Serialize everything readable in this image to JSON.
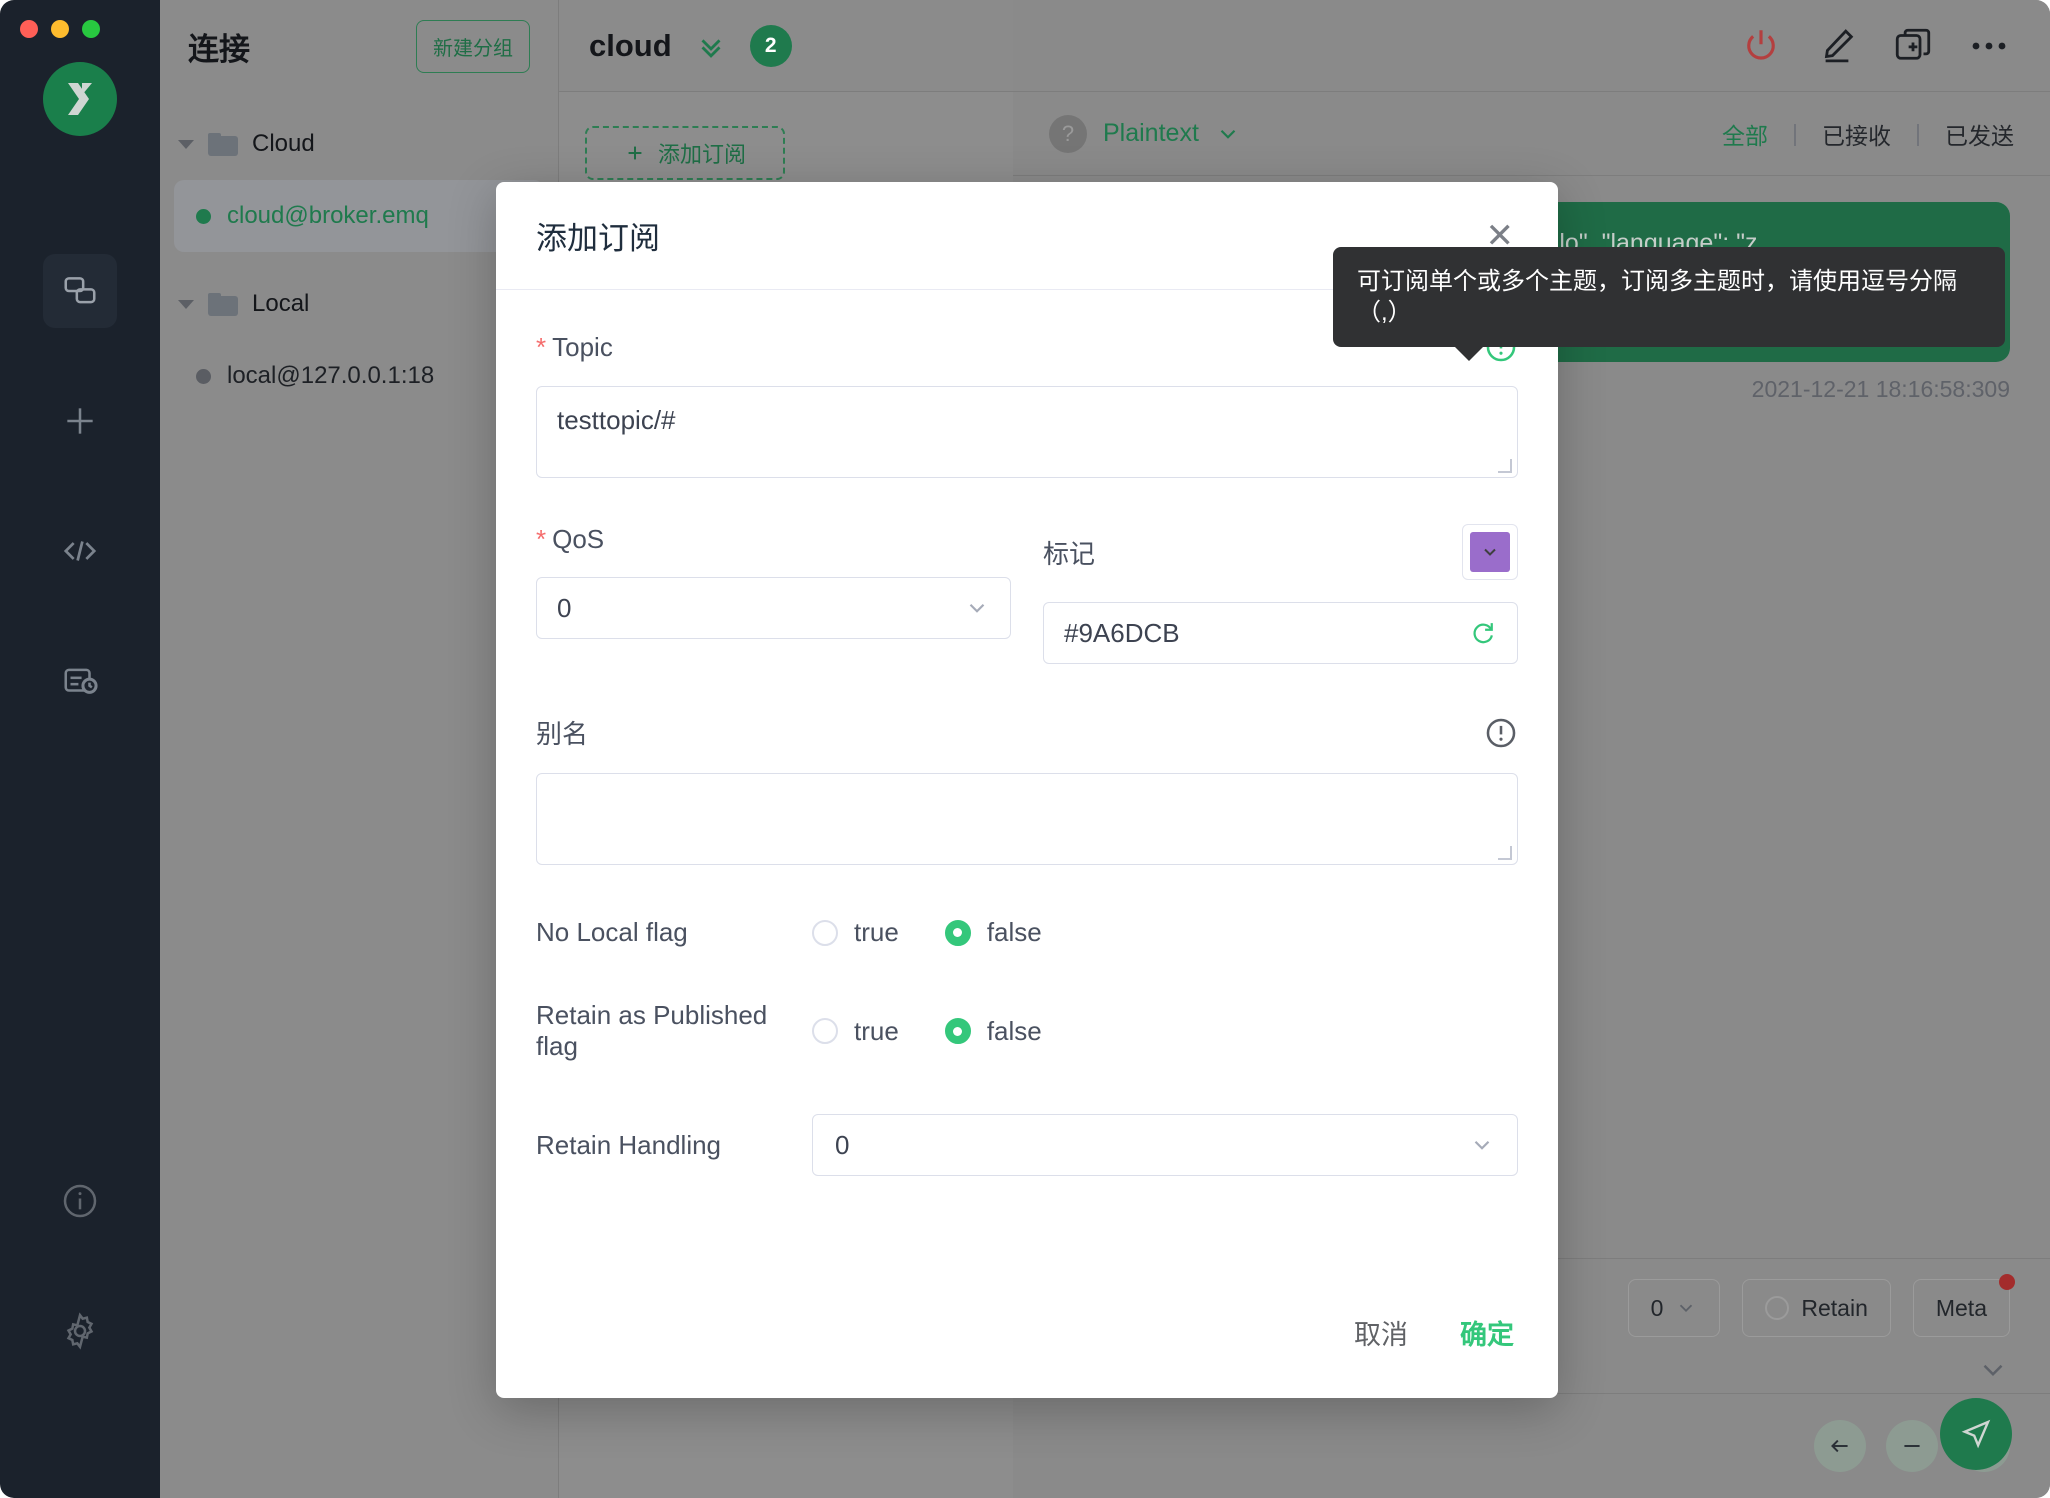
{
  "window": {
    "traffic_lights": [
      "close",
      "minimize",
      "maximize"
    ],
    "brand": "MQTTX"
  },
  "rail": {
    "items": [
      {
        "name": "connections-icon",
        "label": "Connections",
        "active": true
      },
      {
        "name": "new-connection-icon",
        "label": "New Connection",
        "active": false
      },
      {
        "name": "script-icon",
        "label": "Script",
        "active": false
      },
      {
        "name": "log-icon",
        "label": "Log",
        "active": false
      }
    ],
    "bottom_items": [
      {
        "name": "about-icon",
        "label": "About"
      },
      {
        "name": "settings-icon",
        "label": "Settings"
      }
    ]
  },
  "connections": {
    "title": "连接",
    "new_group_label": "新建分组",
    "groups": [
      {
        "name": "Cloud",
        "items": [
          {
            "label": "cloud@broker.emq",
            "connected": true,
            "selected": true
          }
        ]
      },
      {
        "name": "Local",
        "items": [
          {
            "label": "local@127.0.0.1:18",
            "connected": false,
            "selected": false
          }
        ]
      }
    ]
  },
  "connection_tab": {
    "name": "cloud",
    "badge": "2",
    "collapse_icon": "double-chevron-down-icon",
    "actions": [
      {
        "name": "disconnect-icon",
        "label": "Disconnect"
      },
      {
        "name": "edit-icon",
        "label": "Edit"
      },
      {
        "name": "new-window-icon",
        "label": "New"
      },
      {
        "name": "more-icon",
        "label": "More"
      }
    ]
  },
  "subscriptions": {
    "add_label": "添加订阅",
    "collapse_icon": "collapse-list-icon"
  },
  "messages": {
    "help_icon": "question-icon",
    "format": "Plaintext",
    "filters": [
      {
        "label": "全部",
        "active": true
      },
      {
        "label": "已接收",
        "active": false
      },
      {
        "label": "已发送",
        "active": false
      }
    ],
    "bubble": {
      "payload": ": { \"test\": \"hello\", \"language\": \"z",
      "timestamp": "2021-12-21 18:16:58:309"
    },
    "footer": {
      "qos_value": "0",
      "retain_label": "Retain",
      "meta_label": "Meta",
      "nav_back_icon": "arrow-left-icon",
      "nav_minus_icon": "minus-icon",
      "nav_forward_icon": "arrow-right-icon",
      "send_icon": "send-icon"
    }
  },
  "modal": {
    "title": "添加订阅",
    "close_icon": "close-icon",
    "topic": {
      "label": "Topic",
      "required": true,
      "value": "testtopic/#",
      "info_icon": "info-circle-icon",
      "info_icon_color": "#34c77b"
    },
    "qos": {
      "label": "QoS",
      "required": true,
      "value": "0",
      "chevron_icon": "chevron-down-icon"
    },
    "tag": {
      "label": "标记",
      "value": "#9A6DCB",
      "swatch_color": "#9A6DCB",
      "swatch_chevron_icon": "chevron-down-icon",
      "refresh_icon": "refresh-icon",
      "refresh_icon_color": "#34c77b"
    },
    "alias": {
      "label": "别名",
      "value": "",
      "info_icon": "info-circle-icon",
      "info_icon_color": "#5a5e66"
    },
    "no_local_flag": {
      "label": "No Local flag",
      "options": [
        "true",
        "false"
      ],
      "selected": "false"
    },
    "retain_as_published_flag": {
      "label": "Retain as Published flag",
      "options": [
        "true",
        "false"
      ],
      "selected": "false"
    },
    "retain_handling": {
      "label": "Retain Handling",
      "value": "0",
      "chevron_icon": "chevron-down-icon"
    },
    "cancel_label": "取消",
    "confirm_label": "确定"
  },
  "tooltip": {
    "text": "可订阅单个或多个主题，订阅多主题时，请使用逗号分隔（,）"
  },
  "colors": {
    "brand_green": "#1f7a4d",
    "accent_green": "#34c77b",
    "tag_purple": "#9A6DCB",
    "required_red": "#f56c6c",
    "rail_bg": "#1b222c",
    "tooltip_bg": "#303133"
  }
}
